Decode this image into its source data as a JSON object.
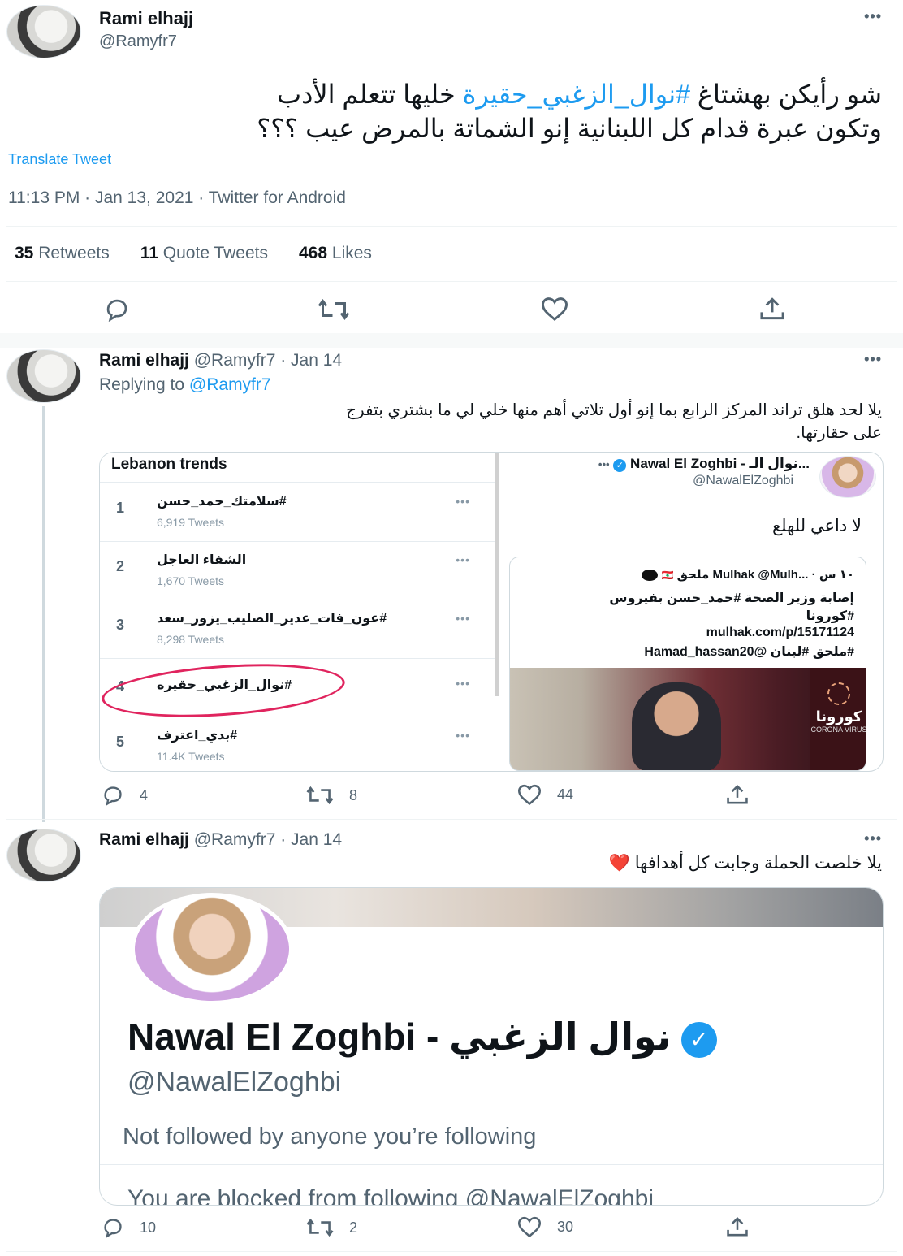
{
  "main_tweet": {
    "author_name": "Rami elhajj",
    "author_handle": "@Ramyfr7",
    "text_part1": "شو رأيكن بهشتاغ ",
    "hashtag": "#نوال_الزغبي_حقيرة",
    "text_part2": " خليها تتعلم الأدب",
    "text_line2": "وتكون عبرة قدام كل اللبنانية إنو الشماتة بالمرض عيب ؟؟؟",
    "translate_label": "Translate Tweet",
    "timestamp": "11:13 PM · Jan 13, 2021 · Twitter for Android",
    "retweets_count": "35",
    "retweets_label": "Retweets",
    "quotes_count": "11",
    "quotes_label": "Quote Tweets",
    "likes_count": "468",
    "likes_label": "Likes"
  },
  "reply1": {
    "author_name": "Rami elhajj",
    "meta": "@Ramyfr7 · Jan 14",
    "replying_prefix": "Replying to",
    "replying_handle": "@Ramyfr7",
    "text_line1": "يلا لحد هلق تراند المركز الرابع بما إنو أول تلاتي أهم منها خلي لي ما بشتري بتفرج",
    "text_line2": "على حقارتها.",
    "trends_panel": {
      "title": "Lebanon trends",
      "items": [
        {
          "rank": "1",
          "tag": "#سلامتك_حمد_حسن",
          "count": "6,919 Tweets"
        },
        {
          "rank": "2",
          "tag": "الشفاء العاجل",
          "count": "1,670 Tweets"
        },
        {
          "rank": "3",
          "tag": "#عون_فات_عدير_الصليب_يزور_سعد",
          "count": "8,298 Tweets"
        },
        {
          "rank": "4",
          "tag": "#نوال_الزغبي_حقيره",
          "count": ""
        },
        {
          "rank": "5",
          "tag": "#بدي_اعترف",
          "count": "11.4K Tweets"
        }
      ]
    },
    "embedded_tweet": {
      "name": "Nawal El Zoghbi - نوال الـ...",
      "handle": "@NawalElZoghbi",
      "text": "لا داعي للهلع",
      "quoted": {
        "header": "ملحق Mulhak  @Mulh... · ١٠ س",
        "line1": "إصابة وزير الصحة #حمد_حسن بفيروس",
        "line2": "#كورونا",
        "line3": "mulhak.com/p/15171124",
        "line4": "#ملحق #لبنان @Hamad_hassan20",
        "badge_ar": "كورونا",
        "badge_en": "CORONA VIRUS"
      }
    },
    "actions": {
      "replies": "4",
      "retweets": "8",
      "likes": "44"
    }
  },
  "reply2": {
    "author_name": "Rami elhajj",
    "meta": "@Ramyfr7 · Jan 14",
    "text": "يلا خلصت الحملة وجابت كل أهدافها",
    "heart_emoji": "❤️",
    "profile_card": {
      "name": "Nawal El Zoghbi - نوال الزغبي",
      "handle": "@NawalElZoghbi",
      "followed_note": "Not followed by anyone you’re following",
      "blocked_note": "You are blocked from following @NawalElZoghbi"
    },
    "actions": {
      "replies": "10",
      "retweets": "2",
      "likes": "30"
    }
  },
  "more_glyph": "•••",
  "colors": {
    "accent": "#1d9bf0",
    "muted": "#536471",
    "border": "#cfd9de",
    "highlight_circle": "#e0245e",
    "heart": "#e0245e"
  }
}
